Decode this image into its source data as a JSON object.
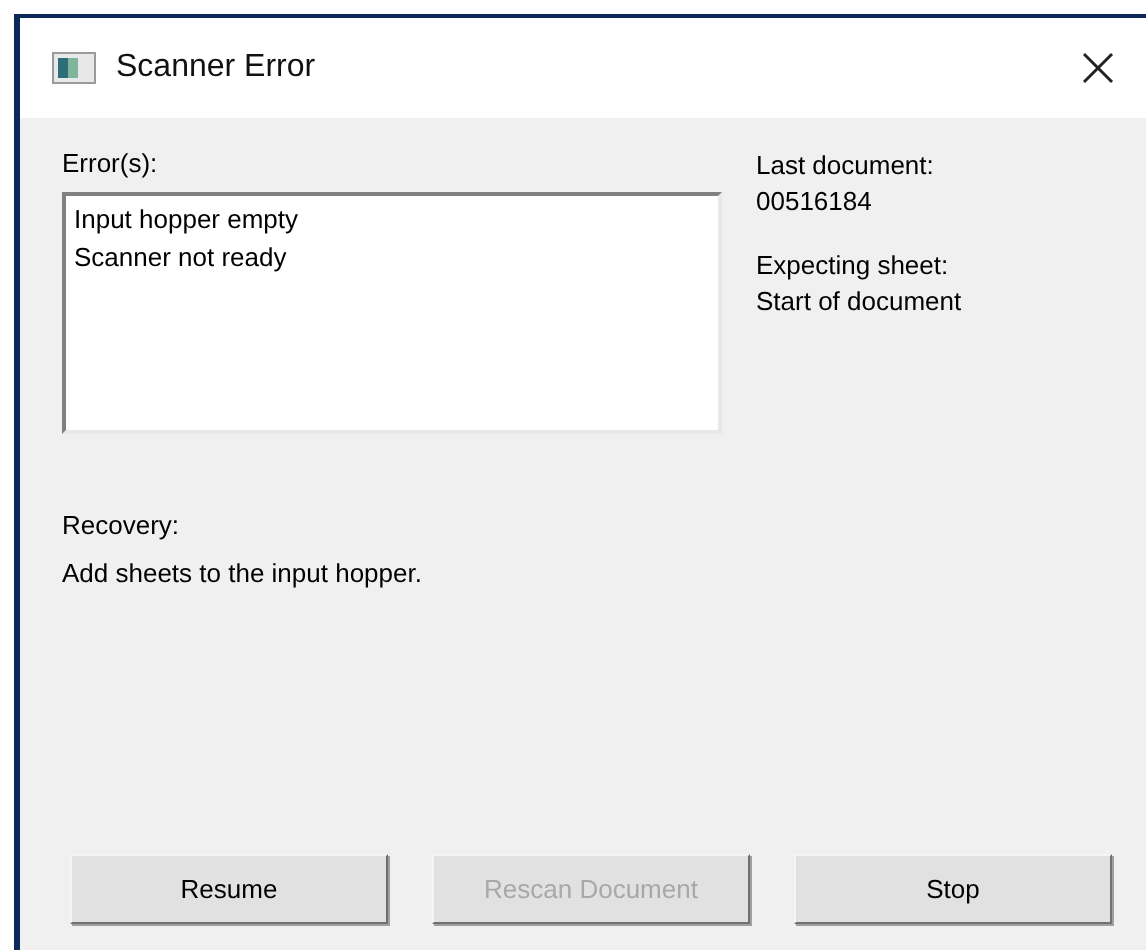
{
  "window": {
    "title": "Scanner Error"
  },
  "errors": {
    "label": "Error(s):",
    "items": [
      "Input hopper empty",
      "Scanner not ready"
    ]
  },
  "info": [
    {
      "label": "Last document:",
      "value": "00516184"
    },
    {
      "label": "Expecting sheet:",
      "value": "Start of document"
    }
  ],
  "recovery": {
    "label": "Recovery:",
    "text": "Add sheets to the input hopper."
  },
  "buttons": [
    {
      "label": "Resume",
      "disabled": false
    },
    {
      "label": "Rescan Document",
      "disabled": true
    },
    {
      "label": "Stop",
      "disabled": false
    }
  ]
}
